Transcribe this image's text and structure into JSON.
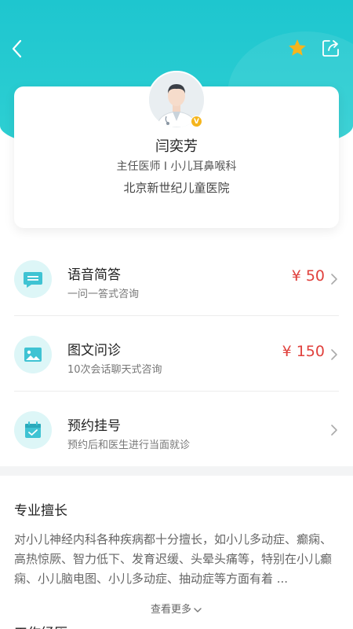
{
  "header": {
    "back_icon": "chevron-left-icon",
    "favorite_icon": "star-icon",
    "share_icon": "share-icon",
    "accent_color": "#1ec6cf",
    "star_color": "#f5b51d"
  },
  "doctor": {
    "avatar_icon": "doctor-avatar-icon",
    "verified_badge": "V",
    "name": "闫奕芳",
    "title": "主任医师 I 小儿耳鼻喉科",
    "hospital": "北京新世纪儿童医院"
  },
  "services": [
    {
      "icon": "chat-bubble-icon",
      "title": "语音简答",
      "desc": "一问一答式咨询",
      "price": "¥ 50"
    },
    {
      "icon": "image-icon",
      "title": "图文问诊",
      "desc": "10次会话聊天式咨询",
      "price": "¥ 150"
    },
    {
      "icon": "calendar-check-icon",
      "title": "预约挂号",
      "desc": "预约后和医生进行当面就诊",
      "price": ""
    }
  ],
  "expertise": {
    "heading": "专业擅长",
    "text": "对小儿神经内科各种疾病都十分擅长，如小儿多动症、癫痫、高热惊厥、智力低下、发育迟缓、头晕头痛等，特别在小儿癫痫、小儿脑电图、小儿多动症、抽动症等方面有着 ...",
    "see_more": "查看更多"
  },
  "work": {
    "heading": "工作经历"
  },
  "colors": {
    "price": "#e0413d",
    "icon_bg": "#ddf6f7",
    "icon_fg": "#3fc3d3"
  }
}
